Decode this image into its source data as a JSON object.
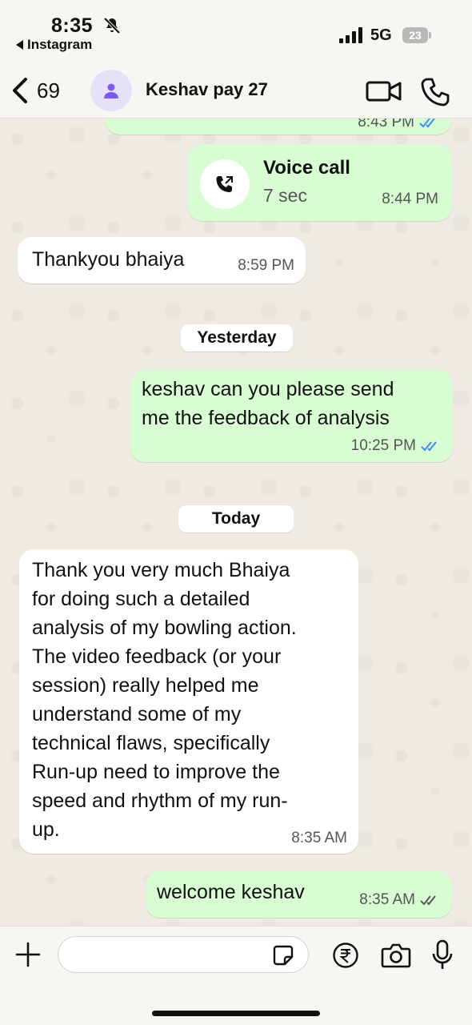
{
  "status_bar": {
    "time": "8:35",
    "back_app": "Instagram",
    "network": "5G",
    "battery": "23",
    "icons": [
      "bell-off-icon",
      "signal-icon",
      "battery-icon"
    ]
  },
  "header": {
    "back_count": "69",
    "contact_name": "Keshav pay 27",
    "icons": [
      "chevron-left-icon",
      "person-icon",
      "video-icon",
      "phone-icon"
    ]
  },
  "chat": {
    "top_partial_time": "8:43 PM",
    "voice_call": {
      "title": "Voice call",
      "duration": "7 sec",
      "time": "8:44 PM"
    },
    "msg_thanks": {
      "text": "Thankyou bhaiya",
      "time": "8:59 PM"
    },
    "date_yesterday": "Yesterday",
    "msg_request": {
      "lines": [
        "keshav can you please send",
        "me the feedback of analysis"
      ],
      "time": "10:25 PM"
    },
    "date_today": "Today",
    "msg_long": {
      "lines": [
        "Thank you very much Bhaiya",
        "for doing such a detailed",
        "analysis of my bowling action.",
        "The video feedback (or your",
        "session) really helped me",
        "understand some of my",
        "technical flaws, specifically",
        "Run-up need to improve the",
        "speed and rhythm of my run-",
        "up."
      ],
      "time": "8:35 AM"
    },
    "msg_welcome": {
      "text": "welcome keshav",
      "time": "8:35 AM"
    },
    "colors": {
      "outgoing": "#d9fdd3",
      "incoming": "#ffffff",
      "read_ticks": "#3f8cf2",
      "avatar_bg": "#e6e0f8",
      "avatar_fg": "#7a5cf0"
    }
  },
  "input_bar": {
    "placeholder": "",
    "icons": [
      "plus-icon",
      "sticker-icon",
      "rupee-icon",
      "camera-icon",
      "microphone-icon"
    ]
  }
}
